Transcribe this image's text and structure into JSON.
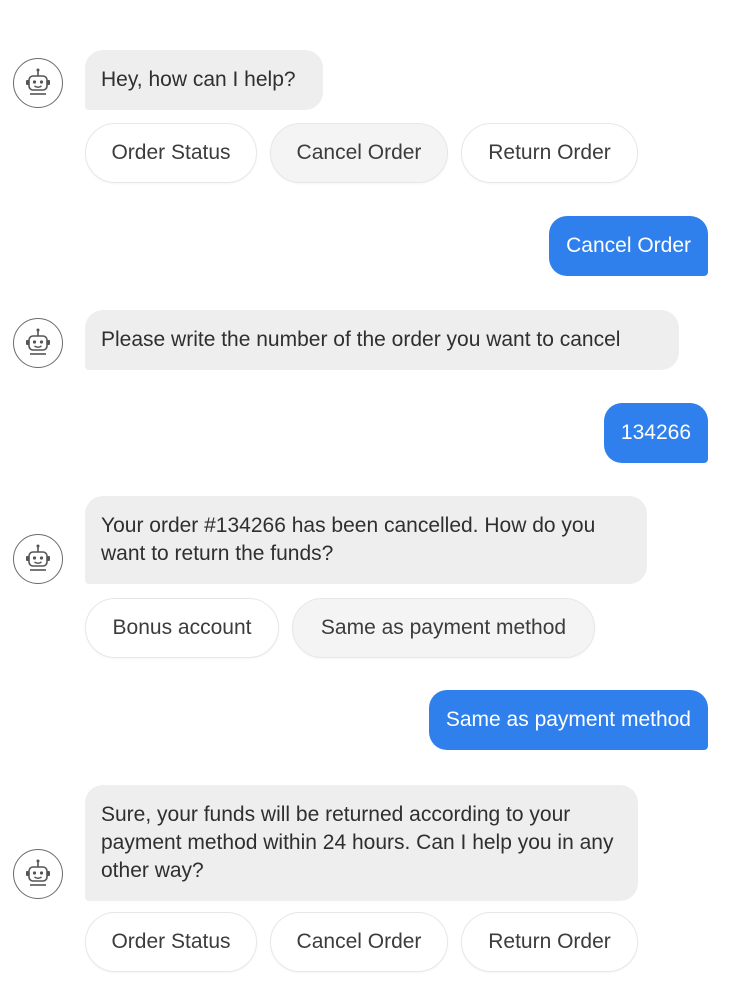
{
  "icons": {
    "bot_avatar": "robot-icon"
  },
  "colors": {
    "user_bubble": "#2f80ed",
    "bot_bubble": "#eeeeee"
  },
  "conversation": {
    "m1": {
      "text": "Hey, how can I help?"
    },
    "chips1": [
      "Order Status",
      "Cancel Order",
      "Return Order"
    ],
    "u1": {
      "text": "Cancel Order"
    },
    "m2": {
      "text": "Please write the number of the order you want to cancel"
    },
    "u2": {
      "text": "134266"
    },
    "m3": {
      "text": "Your order #134266 has been cancelled. How do you want to return the funds?"
    },
    "chips2": [
      "Bonus account",
      "Same as payment method"
    ],
    "u3": {
      "text": "Same as payment method"
    },
    "m4": {
      "text": "Sure, your funds will be returned according to your payment method within 24 hours. Can I help you in any other way?"
    },
    "chips3": [
      "Order Status",
      "Cancel Order",
      "Return Order"
    ]
  }
}
